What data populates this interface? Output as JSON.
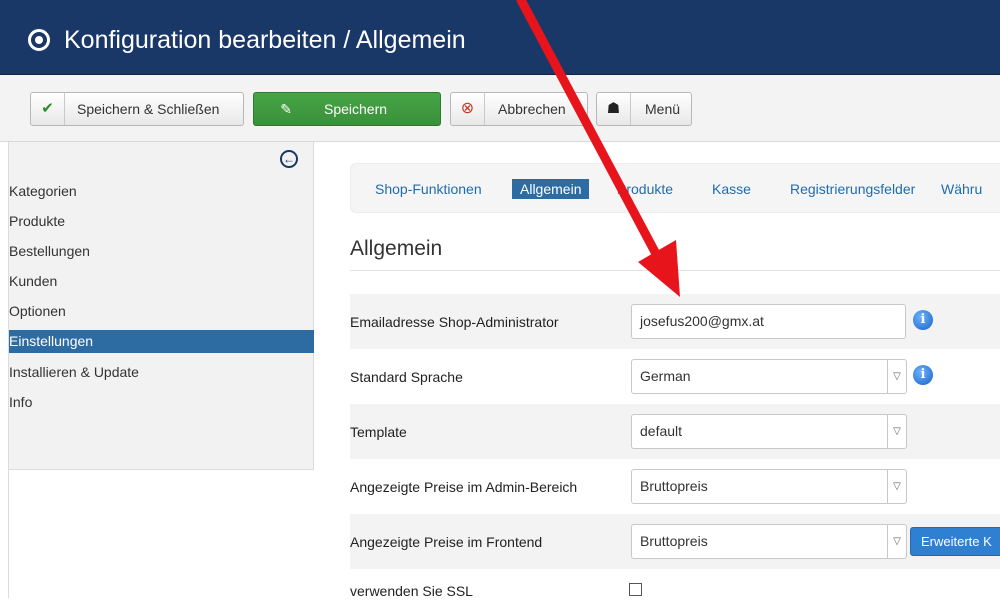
{
  "header": {
    "title": "Konfiguration bearbeiten / Allgemein",
    "logo_icon": "joomla-circle-icon"
  },
  "toolbar": {
    "save_close_label": "Speichern & Schließen",
    "save_label": "Speichern",
    "cancel_label": "Abbrechen",
    "menu_label": "Menü"
  },
  "sidebar": {
    "items": [
      {
        "label": "Kategorien"
      },
      {
        "label": "Produkte"
      },
      {
        "label": "Bestellungen"
      },
      {
        "label": "Kunden"
      },
      {
        "label": "Optionen"
      },
      {
        "label": "Einstellungen"
      },
      {
        "label": "Installieren & Update"
      },
      {
        "label": "Info"
      }
    ],
    "active": "Einstellungen"
  },
  "tabs": [
    {
      "label": "Shop-Funktionen"
    },
    {
      "label": "Allgemein"
    },
    {
      "label": "Produkte"
    },
    {
      "label": "Kasse"
    },
    {
      "label": "Registrierungsfelder"
    },
    {
      "label": "Währu"
    }
  ],
  "section": {
    "title": "Allgemein"
  },
  "form": {
    "admin_email": {
      "label": "Emailadresse Shop-Administrator",
      "value": "josefus200@gmx.at"
    },
    "language": {
      "label": "Standard Sprache",
      "value": "German"
    },
    "template": {
      "label": "Template",
      "value": "default"
    },
    "admin_prices": {
      "label": "Angezeigte Preise im Admin-Bereich",
      "value": "Bruttopreis"
    },
    "frontend_prices": {
      "label": "Angezeigte Preise im Frontend",
      "value": "Bruttopreis",
      "advanced_label": "Erweiterte K"
    },
    "ssl": {
      "label": "verwenden Sie SSL",
      "checked": false
    }
  },
  "colors": {
    "header": "#1a3867",
    "accent": "#2d6ca2",
    "save": "#46a546",
    "arrow": "#e8141c"
  }
}
